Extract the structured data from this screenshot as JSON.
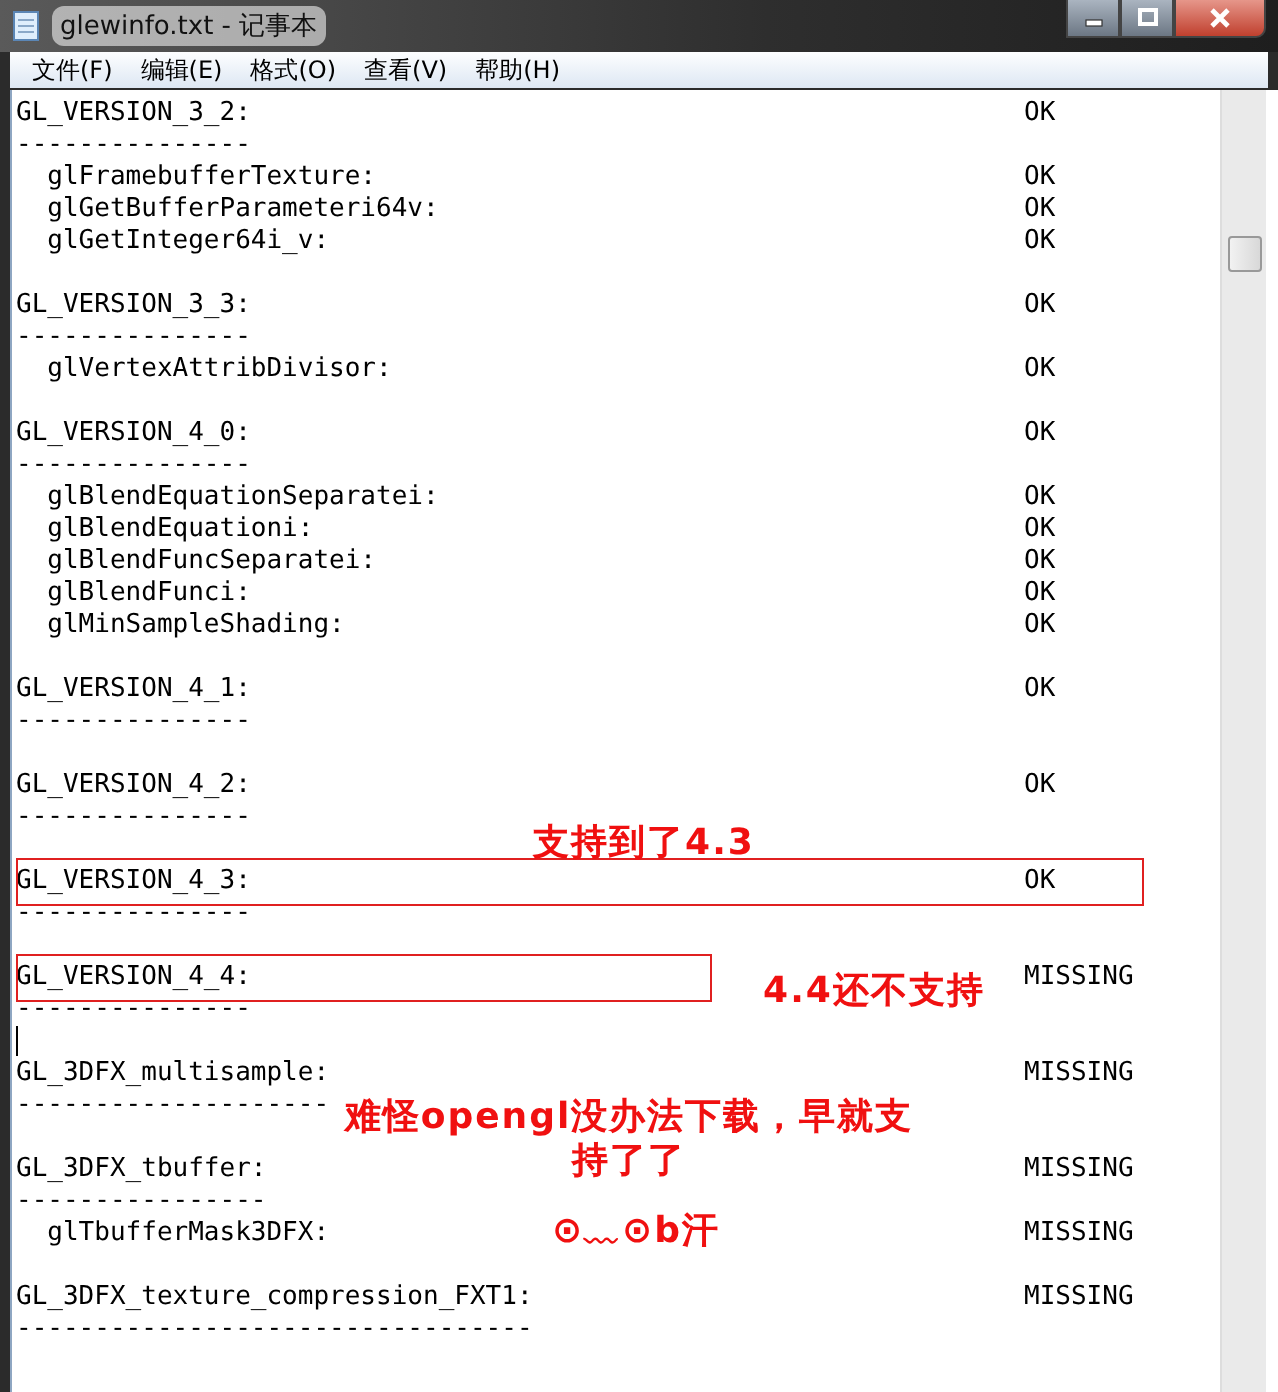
{
  "window": {
    "title": "glewinfo.txt - 记事本"
  },
  "menu": [
    "文件(F)",
    "编辑(E)",
    "格式(O)",
    "查看(V)",
    "帮助(H)"
  ],
  "sections": [
    {
      "header": "GL_VERSION_3_2:",
      "status": "OK",
      "rule": "---------------",
      "entries": [
        {
          "text": "  glFramebufferTexture:",
          "status": "OK"
        },
        {
          "text": "  glGetBufferParameteri64v:",
          "status": "OK"
        },
        {
          "text": "  glGetInteger64i_v:",
          "status": "OK"
        }
      ]
    },
    {
      "header": "GL_VERSION_3_3:",
      "status": "OK",
      "rule": "---------------",
      "entries": [
        {
          "text": "  glVertexAttribDivisor:",
          "status": "OK"
        }
      ]
    },
    {
      "header": "GL_VERSION_4_0:",
      "status": "OK",
      "rule": "---------------",
      "entries": [
        {
          "text": "  glBlendEquationSeparatei:",
          "status": "OK"
        },
        {
          "text": "  glBlendEquationi:",
          "status": "OK"
        },
        {
          "text": "  glBlendFuncSeparatei:",
          "status": "OK"
        },
        {
          "text": "  glBlendFunci:",
          "status": "OK"
        },
        {
          "text": "  glMinSampleShading:",
          "status": "OK"
        }
      ]
    },
    {
      "header": "GL_VERSION_4_1:",
      "status": "OK",
      "rule": "---------------"
    },
    {
      "header": "GL_VERSION_4_2:",
      "status": "OK",
      "rule": "---------------"
    },
    {
      "header": "GL_VERSION_4_3:",
      "status": "OK",
      "rule": "---------------",
      "boxed": true
    },
    {
      "header": "GL_VERSION_4_4:",
      "status": "MISSING",
      "rule": "---------------",
      "boxed": true,
      "cursor": true
    },
    {
      "header": "GL_3DFX_multisample:",
      "status": "MISSING",
      "rule": "--------------------"
    },
    {
      "header": "GL_3DFX_tbuffer:",
      "status": "MISSING",
      "rule": "----------------",
      "entries": [
        {
          "text": "  glTbufferMask3DFX:",
          "status": "MISSING"
        }
      ]
    },
    {
      "header": "GL_3DFX_texture_compression_FXT1:",
      "status": "MISSING",
      "rule": "---------------------------------"
    }
  ],
  "annotations": [
    {
      "kind": "text",
      "text": "支持到了4.3"
    },
    {
      "kind": "text",
      "text": "4.4还不支持"
    },
    {
      "kind": "text",
      "text": "难怪opengl没办法下载，早就支持了了"
    },
    {
      "kind": "text",
      "text": "⊙﹏⊙b汗"
    }
  ]
}
